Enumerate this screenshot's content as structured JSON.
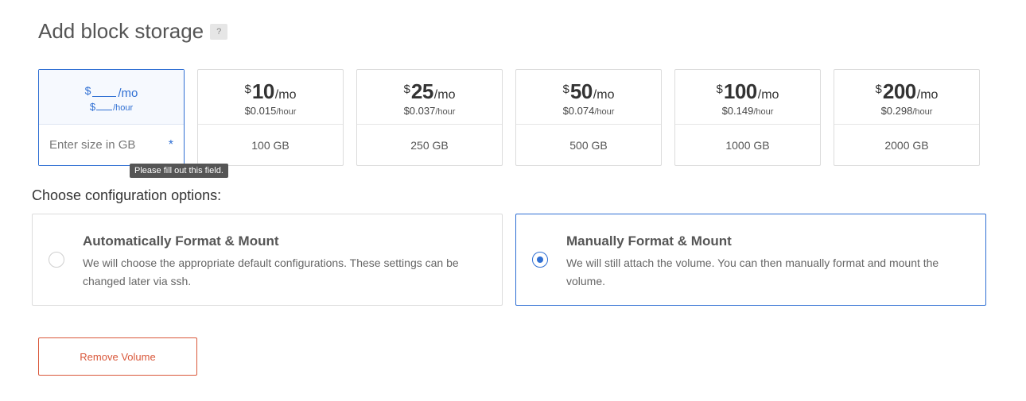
{
  "page": {
    "title": "Add block storage",
    "help_label": "?"
  },
  "custom_plan": {
    "currency": "$",
    "month_unit": "/mo",
    "hour_unit": "/hour",
    "size_placeholder": "Enter size in GB",
    "required_marker": "*",
    "tooltip": "Please fill out this field."
  },
  "plans": [
    {
      "currency": "$",
      "amount": "10",
      "month_unit": "/mo",
      "hourly": "$0.015",
      "hour_unit": "/hour",
      "size": "100 GB"
    },
    {
      "currency": "$",
      "amount": "25",
      "month_unit": "/mo",
      "hourly": "$0.037",
      "hour_unit": "/hour",
      "size": "250 GB"
    },
    {
      "currency": "$",
      "amount": "50",
      "month_unit": "/mo",
      "hourly": "$0.074",
      "hour_unit": "/hour",
      "size": "500 GB"
    },
    {
      "currency": "$",
      "amount": "100",
      "month_unit": "/mo",
      "hourly": "$0.149",
      "hour_unit": "/hour",
      "size": "1000 GB"
    },
    {
      "currency": "$",
      "amount": "200",
      "month_unit": "/mo",
      "hourly": "$0.298",
      "hour_unit": "/hour",
      "size": "2000 GB"
    }
  ],
  "config": {
    "label": "Choose configuration options:",
    "options": [
      {
        "title": "Automatically Format & Mount",
        "description": "We will choose the appropriate default configurations. These settings can be changed later via ssh.",
        "selected": false
      },
      {
        "title": "Manually Format & Mount",
        "description": "We will still attach the volume. You can then manually format and mount the volume.",
        "selected": true
      }
    ]
  },
  "actions": {
    "remove_label": "Remove Volume"
  },
  "colors": {
    "accent": "#2f6fd3",
    "danger": "#d9573a"
  }
}
